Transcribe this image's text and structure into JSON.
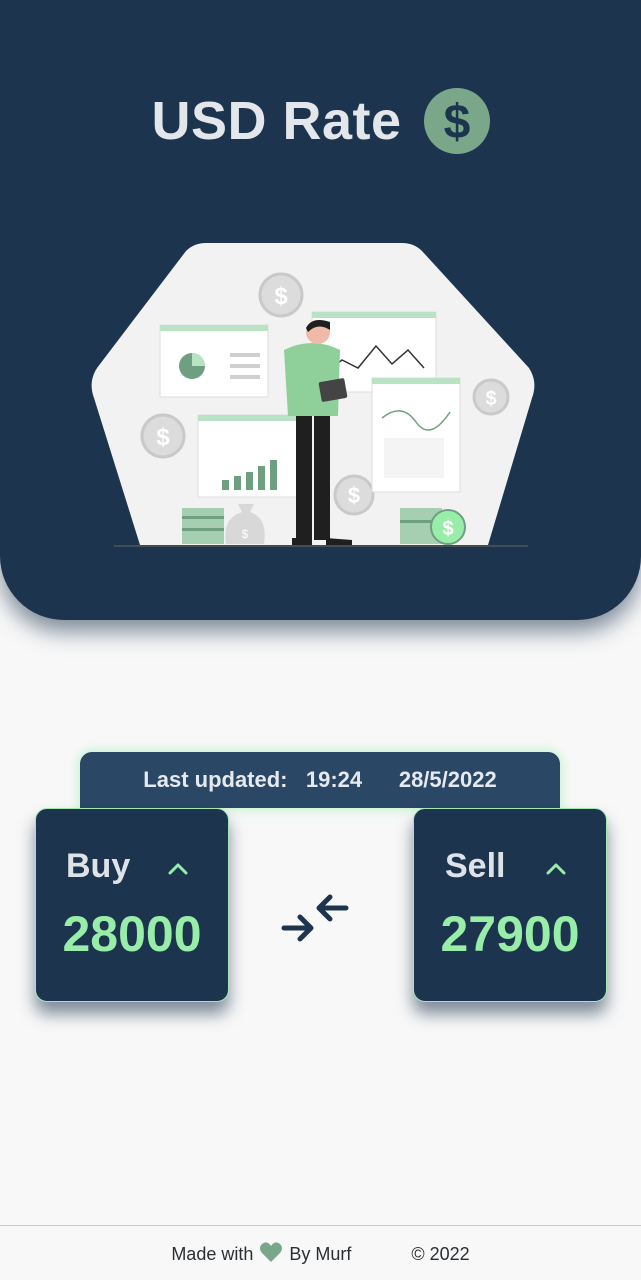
{
  "header": {
    "title": "USD Rate",
    "badge_icon": "dollar-circle-icon",
    "hero_icon": "finance-illustration-icon"
  },
  "status": {
    "last_updated_label": "Last updated:",
    "time": "19:24",
    "date": "28/5/2022"
  },
  "rates": {
    "buy": {
      "label": "Buy",
      "value": "28000",
      "trend_icon": "chevron-up-icon"
    },
    "sell": {
      "label": "Sell",
      "value": "27900",
      "trend_icon": "chevron-up-icon"
    },
    "exchange_icon": "swap-arrows-icon"
  },
  "footer": {
    "made_with": "Made with",
    "by": "By Murf",
    "copyright": "© 2022",
    "heart_icon": "heart-icon"
  },
  "colors": {
    "primary": "#1d344f",
    "accent_green": "#98eda8",
    "badge_green": "#7aa68a",
    "background": "#f8f8f8"
  }
}
